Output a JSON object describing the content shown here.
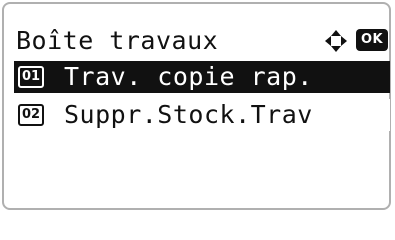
{
  "header": {
    "title": "Boîte travaux",
    "nav_icon": "four-way-arrow-icon",
    "ok_label": "OK"
  },
  "menu": {
    "selected_index": 1,
    "items": [
      {
        "number": "01",
        "label": "Trav. copie rap."
      },
      {
        "number": "02",
        "label": "Suppr.Stock.Trav"
      }
    ]
  },
  "colors": {
    "foreground": "#111111",
    "background": "#ffffff",
    "frame": "#b0b0b0"
  }
}
